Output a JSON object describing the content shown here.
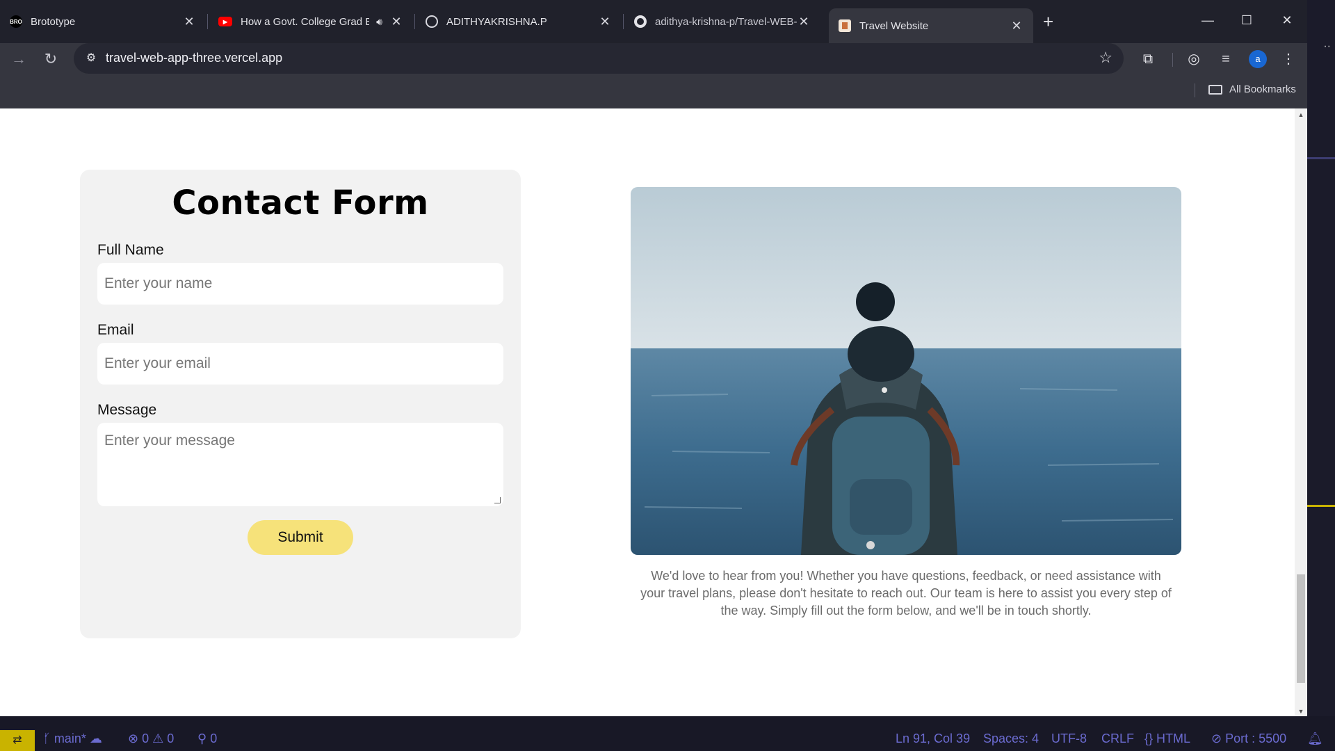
{
  "browser": {
    "tabs": [
      {
        "title": "Brototype",
        "favicon": "brototype-logo"
      },
      {
        "title": "How a Govt. College Grad B",
        "favicon": "youtube-icon"
      },
      {
        "title": "ADITHYAKRISHNA.P",
        "favicon": "globe-icon"
      },
      {
        "title": "adithya-krishna-p/Travel-WEB-/",
        "favicon": "github-icon"
      },
      {
        "title": "Travel Website",
        "favicon": "site-favicon",
        "active": true
      }
    ],
    "favicon_label": "BRO",
    "url": "travel-web-app-three.vercel.app",
    "profile_initial": "a",
    "bookmarks_label": "All Bookmarks"
  },
  "contact": {
    "title": "Contact Form",
    "name_label": "Full Name",
    "name_placeholder": "Enter your name",
    "email_label": "Email",
    "email_placeholder": "Enter your email",
    "message_label": "Message",
    "message_placeholder": "Enter your message",
    "submit_label": "Submit"
  },
  "side": {
    "description": "We'd love to hear from you! Whether you have questions, feedback, or need assistance with your travel plans, please don't hesitate to reach out. Our team is here to assist you every step of the way. Simply fill out the form below, and we'll be in touch shortly."
  },
  "statusbar": {
    "branch": "main*",
    "errors": "0",
    "warnings": "0",
    "ports": "0",
    "cursor": "Ln 91, Col 39",
    "spaces": "Spaces: 4",
    "encoding": "UTF-8",
    "eol": "CRLF",
    "language": "HTML",
    "port": "Port : 5500"
  },
  "colors": {
    "submit_bg": "#f6e27a",
    "form_bg": "#f2f2f2",
    "statusbar_text": "#6b6bd0",
    "remote_bg": "#c9b300"
  }
}
